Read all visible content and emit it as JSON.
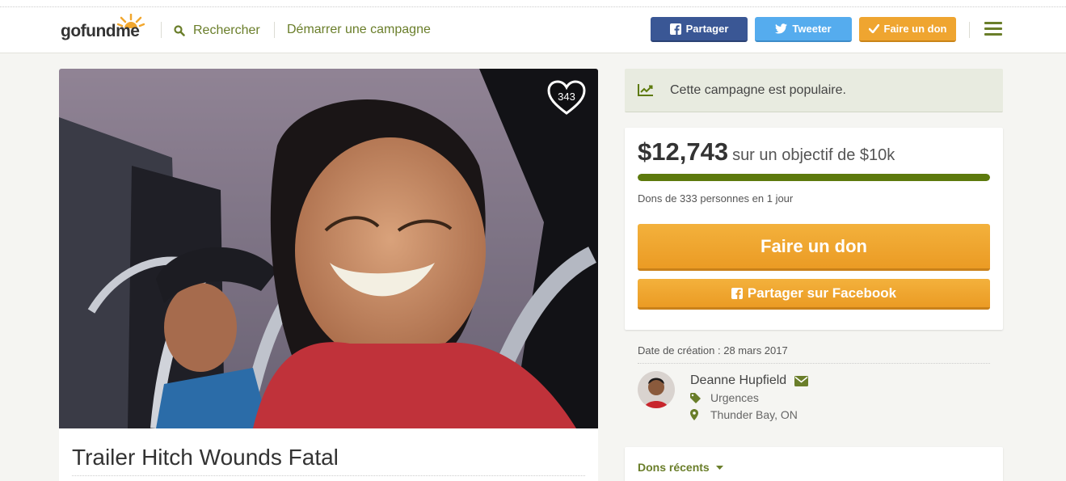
{
  "header": {
    "logo_text": "gofundme",
    "search_label": "Rechercher",
    "start_campaign": "Démarrer une campagne",
    "share_label": "Partager",
    "tweet_label": "Tweeter",
    "donate_label": "Faire un don"
  },
  "campaign": {
    "title": "Trailer Hitch Wounds Fatal",
    "hearts_count": "343",
    "popular_text": "Cette campagne est populaire.",
    "raised": "$12,743",
    "goal_text": "sur un objectif de $10k",
    "progress_fraction": 1.0,
    "stats": "Dons de 333 personnes en 1 jour",
    "donate_button": "Faire un don",
    "share_button": "Partager sur Facebook",
    "created": "Date de création : 28 mars 2017",
    "organizer": "Deanne Hupfield",
    "category": "Urgences",
    "location": "Thunder Bay, ON",
    "recent_donations": "Dons récents"
  },
  "colors": {
    "accent_green": "#6a7e2a",
    "progress_green": "#5d7a0d",
    "facebook_blue": "#3a5795",
    "twitter_blue": "#55acee",
    "donate_orange": "#efa530"
  },
  "icons": {
    "search": "search-icon",
    "facebook": "facebook-icon",
    "twitter": "twitter-icon",
    "check": "check-icon",
    "menu": "hamburger-menu-icon",
    "trend": "trending-up-icon",
    "heart": "heart-icon",
    "envelope": "envelope-icon",
    "tag": "tag-icon",
    "location": "map-pin-icon",
    "caret": "caret-down-icon"
  }
}
